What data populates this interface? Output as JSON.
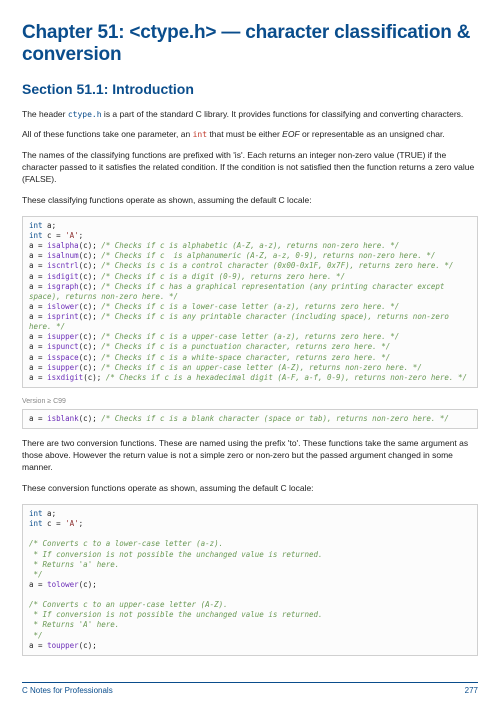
{
  "chapter_title": "Chapter 51: <ctype.h> — character classification & conversion",
  "section_title": "Section 51.1: Introduction",
  "p1a": "The header ",
  "p1code": "ctype.h",
  "p1b": " is a part of the standard C library. It provides functions for classifying and converting characters.",
  "p2a": "All of these functions take one parameter, an ",
  "p2kw": "int",
  "p2b": " that must be either ",
  "p2c": "EOF",
  "p2d": " or representable as an unsigned char.",
  "p3": "The names of the classifying functions are prefixed with 'is'. Each returns an integer non-zero value (TRUE) if the character passed to it satisfies the related condition. If the condition is not satisfied then the function returns a zero value (FALSE).",
  "p4": "These classifying functions operate as shown, assuming the default C locale:",
  "code1": {
    "l1_kw": "int",
    "l1_id": " a;",
    "l2_kw": "int",
    "l2_id": " c = ",
    "l2_num": "'A'",
    "l2_b": ";",
    "l3_a": "a = ",
    "l3_fn": "isalpha",
    "l3_b": "(c); ",
    "l3_com": "/* Checks if c is alphabetic (A-Z, a-z), returns non-zero here. */",
    "l4_a": "a = ",
    "l4_fn": "isalnum",
    "l4_b": "(c); ",
    "l4_com": "/* Checks if c  is alphanumeric (A-Z, a-z, 0-9), returns non-zero here. */",
    "l5_a": "a = ",
    "l5_fn": "iscntrl",
    "l5_b": "(c); ",
    "l5_com": "/* Checks is c is a control character (0x00-0x1F, 0x7F), returns zero here. */",
    "l6_a": "a = ",
    "l6_fn": "isdigit",
    "l6_b": "(c); ",
    "l6_com": "/* Checks if c is a digit (0-9), returns zero here. */",
    "l7_a": "a = ",
    "l7_fn": "isgraph",
    "l7_b": "(c); ",
    "l7_com": "/* Checks if c has a graphical representation (any printing character except space), returns non-zero here. */",
    "l8_a": "a = ",
    "l8_fn": "islower",
    "l8_b": "(c); ",
    "l8_com": "/* Checks if c is a lower-case letter (a-z), returns zero here. */",
    "l9_a": "a = ",
    "l9_fn": "isprint",
    "l9_b": "(c); ",
    "l9_com": "/* Checks if c is any printable character (including space), returns non-zero here. */",
    "l10_a": "a = ",
    "l10_fn": "isupper",
    "l10_b": "(c); ",
    "l10_com": "/* Checks if c is a upper-case letter (a-z), returns zero here. */",
    "l11_a": "a = ",
    "l11_fn": "ispunct",
    "l11_b": "(c); ",
    "l11_com": "/* Checks if c is a punctuation character, returns zero here. */",
    "l12_a": "a = ",
    "l12_fn": "isspace",
    "l12_b": "(c); ",
    "l12_com": "/* Checks if c is a white-space character, returns zero here. */",
    "l13_a": "a = ",
    "l13_fn": "isupper",
    "l13_b": "(c); ",
    "l13_com": "/* Checks if c is an upper-case letter (A-Z), returns non-zero here. */",
    "l14_a": "a = ",
    "l14_fn": "isxdigit",
    "l14_b": "(c); ",
    "l14_com": "/* Checks if c is a hexadecimal digit (A-F, a-f, 0-9), returns non-zero here. */"
  },
  "version_label": "Version ≥ C99",
  "code2": {
    "a": "a = ",
    "fn": "isblank",
    "b": "(c); ",
    "com": "/* Checks if c is a blank character (space or tab), returns non-zero here. */"
  },
  "p5": "There are two conversion functions. These are named using the prefix 'to'. These functions take the same argument as those above. However the return value is not a simple zero or non-zero but the passed argument changed in some manner.",
  "p6": "These conversion functions operate as shown, assuming the default C locale:",
  "code3": {
    "l1_kw": "int",
    "l1_id": " a;",
    "l2_kw": "int",
    "l2_id": " c = ",
    "l2_num": "'A'",
    "l2_b": ";",
    "c1_1": "/* Converts c to a lower-case letter (a-z).",
    "c1_2": " * If conversion is not possible the unchanged value is returned.",
    "c1_3": " * Returns 'a' here.",
    "c1_4": " */",
    "l3_a": "a = ",
    "l3_fn": "tolower",
    "l3_b": "(c);",
    "c2_1": "/* Converts c to an upper-case letter (A-Z).",
    "c2_2": " * If conversion is not possible the unchanged value is returned.",
    "c2_3": " * Returns 'A' here.",
    "c2_4": " */",
    "l4_a": "a = ",
    "l4_fn": "toupper",
    "l4_b": "(c);"
  },
  "footer_left": "C Notes for Professionals",
  "footer_right": "277"
}
